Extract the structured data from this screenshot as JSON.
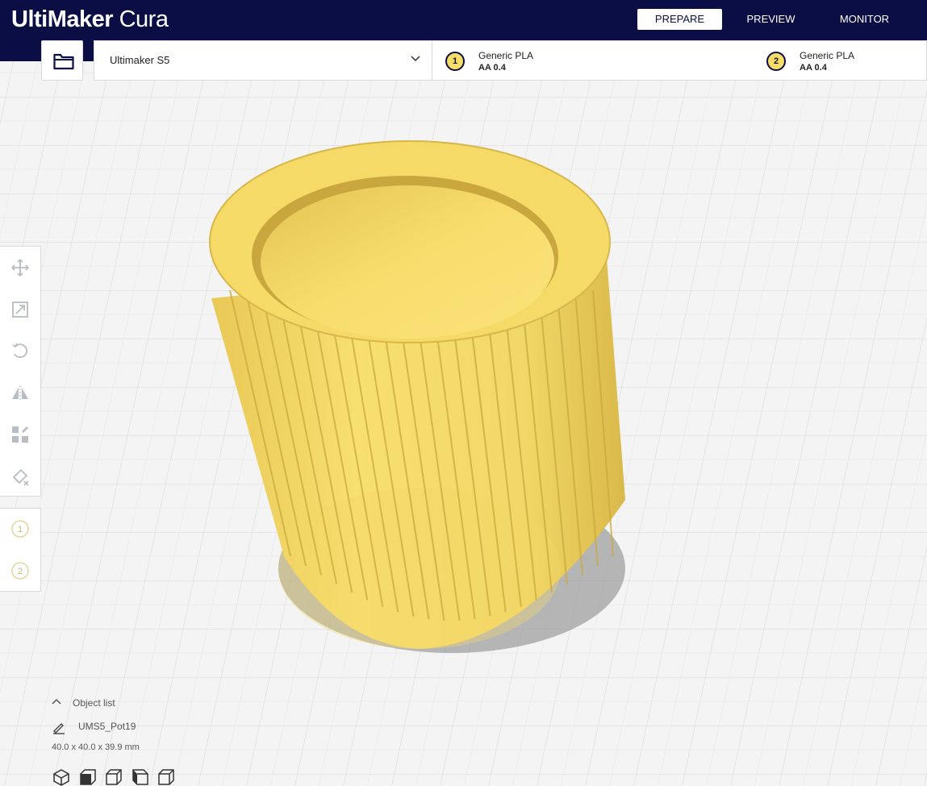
{
  "app": {
    "logo_bold": "UltiMaker",
    "logo_light": "Cura"
  },
  "stages": {
    "prepare": "PREPARE",
    "preview": "PREVIEW",
    "monitor": "MONITOR",
    "active": "PREPARE"
  },
  "printer": {
    "name": "Ultimaker S5"
  },
  "extruders": [
    {
      "number": "1",
      "material": "Generic PLA",
      "core": "AA 0.4"
    },
    {
      "number": "2",
      "material": "Generic PLA",
      "core": "AA 0.4"
    }
  ],
  "tools": {
    "icons": [
      "move-icon",
      "scale-icon",
      "rotate-icon",
      "mirror-icon",
      "per-model-settings-icon",
      "support-blocker-icon"
    ]
  },
  "object_list": {
    "title": "Object list",
    "object_name": "UMS5_Pot19",
    "dimensions": "40.0 x 40.0 x 39.9 mm"
  },
  "view_buttons": [
    "3d-view-icon",
    "front-view-icon",
    "top-view-icon",
    "left-view-icon",
    "right-view-icon"
  ],
  "colors": {
    "header": "#0b0e44",
    "model": "#f6dd6a",
    "build_plate": "#f3f3f3"
  }
}
